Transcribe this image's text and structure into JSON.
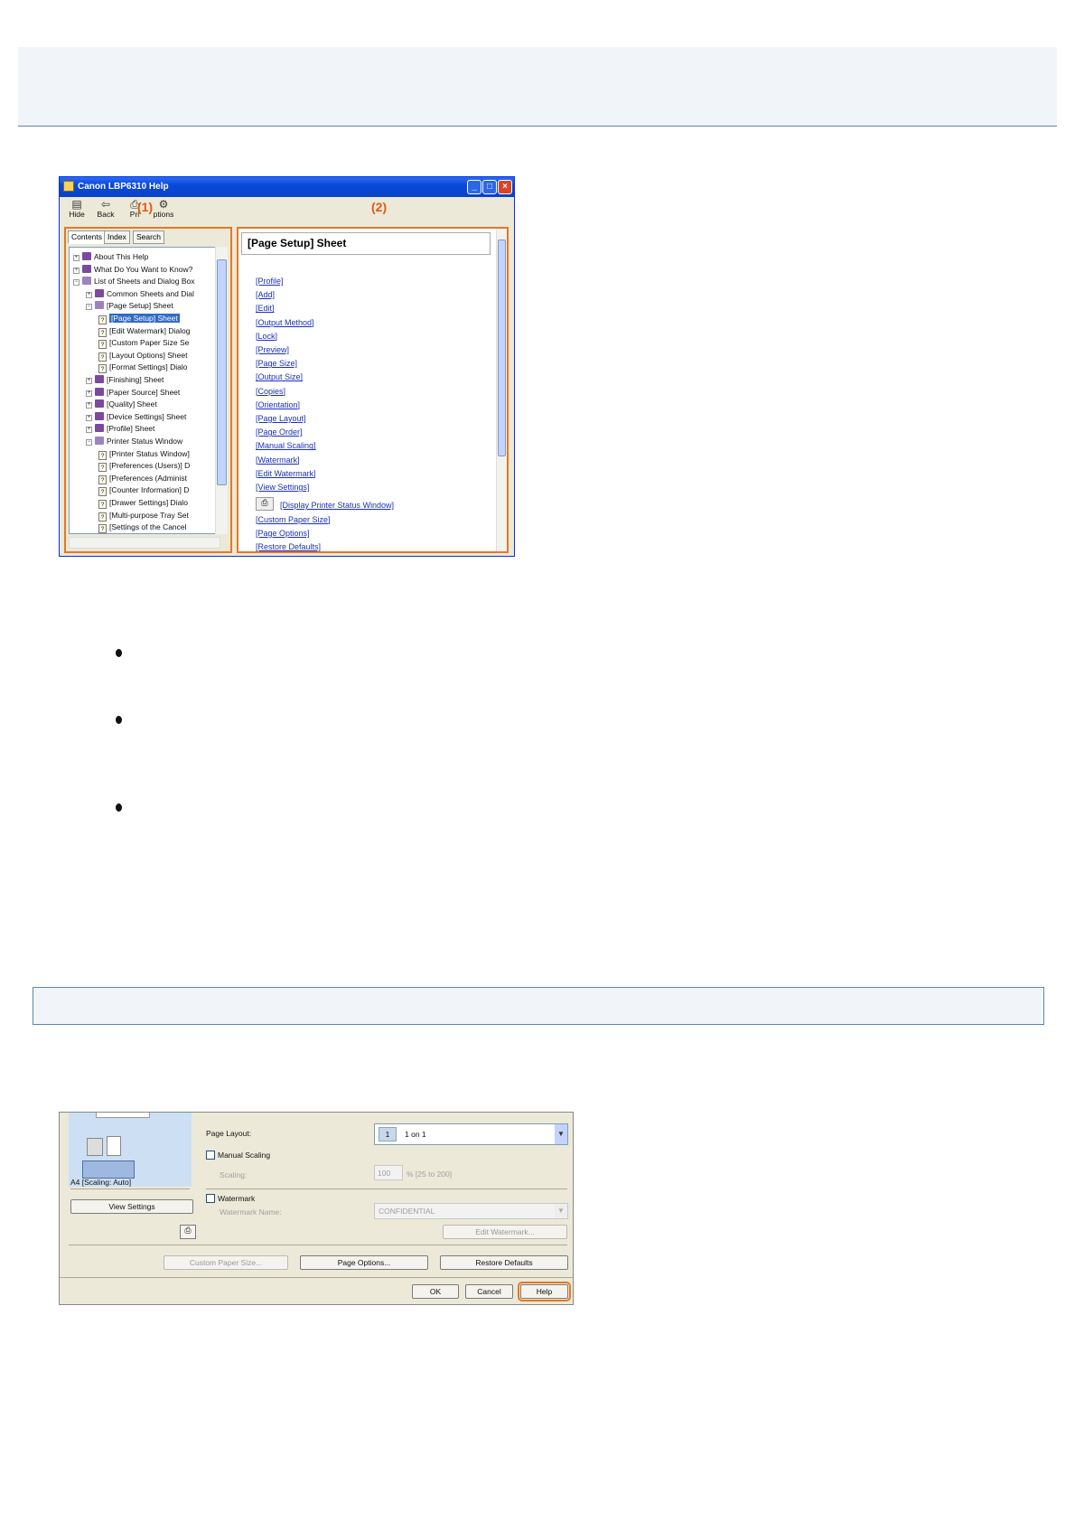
{
  "help_window": {
    "title": "Canon LBP6310 Help",
    "toolbar": {
      "hide": "Hide",
      "back": "Back",
      "print": "Pri",
      "options": "ptions"
    },
    "callout_1": "(1)",
    "callout_2": "(2)",
    "tabs": [
      "Contents",
      "Index",
      "Search"
    ],
    "tree": [
      {
        "label": "About This Help",
        "kind": "book",
        "level": 0
      },
      {
        "label": "What Do You Want to Know?",
        "kind": "book",
        "level": 0
      },
      {
        "label": "List of Sheets and Dialog Box",
        "kind": "open",
        "level": 0
      },
      {
        "label": "Common Sheets and Dial",
        "kind": "book",
        "level": 1
      },
      {
        "label": "[Page Setup] Sheet",
        "kind": "open",
        "level": 1
      },
      {
        "label": "[Page Setup] Sheet",
        "kind": "page",
        "level": 2,
        "selected": true
      },
      {
        "label": "[Edit Watermark] Dialog",
        "kind": "page",
        "level": 2
      },
      {
        "label": "[Custom Paper Size Se",
        "kind": "page",
        "level": 2
      },
      {
        "label": "[Layout Options] Sheet",
        "kind": "page",
        "level": 2
      },
      {
        "label": "[Format Settings] Dialo",
        "kind": "page",
        "level": 2
      },
      {
        "label": "[Finishing] Sheet",
        "kind": "book",
        "level": 1
      },
      {
        "label": "[Paper Source] Sheet",
        "kind": "book",
        "level": 1
      },
      {
        "label": "[Quality] Sheet",
        "kind": "book",
        "level": 1
      },
      {
        "label": "[Device Settings] Sheet",
        "kind": "book",
        "level": 1
      },
      {
        "label": "[Profile] Sheet",
        "kind": "book",
        "level": 1
      },
      {
        "label": "Printer Status Window",
        "kind": "open",
        "level": 1
      },
      {
        "label": "[Printer Status Window]",
        "kind": "page",
        "level": 2
      },
      {
        "label": "[Preferences (Users)] D",
        "kind": "page",
        "level": 2
      },
      {
        "label": "[Preferences (Administ",
        "kind": "page",
        "level": 2
      },
      {
        "label": "[Counter Information] D",
        "kind": "page",
        "level": 2
      },
      {
        "label": "[Drawer Settings] Dialo",
        "kind": "page",
        "level": 2
      },
      {
        "label": "[Multi-purpose Tray Set",
        "kind": "page",
        "level": 2
      },
      {
        "label": "[Settings of the Cancel",
        "kind": "page",
        "level": 2
      }
    ],
    "content_title": "[Page Setup] Sheet",
    "links": [
      "[Profile]",
      "[Add]",
      "[Edit]",
      "[Output Method]",
      "[Lock]",
      "[Preview]",
      "[Page Size]",
      "[Output Size]",
      "[Copies]",
      "[Orientation]",
      "[Page Layout]",
      "[Page Order]",
      "[Manual Scaling]",
      "[Watermark]",
      "[Edit Watermark]",
      "[View Settings]"
    ],
    "link_status_window": "[Display Printer Status Window]",
    "links_after": [
      "[Custom Paper Size]",
      "[Page Options]",
      "[Restore Defaults]"
    ]
  },
  "dialog": {
    "preview_caption": "A4 [Scaling: Auto]",
    "view_settings": "View Settings",
    "page_layout_label": "Page Layout:",
    "page_layout_value": "1 on 1",
    "page_layout_num": "1",
    "manual_scaling": "Manual Scaling",
    "scaling_label": "Scaling:",
    "scaling_value": "100",
    "scaling_range": "% [25 to 200]",
    "watermark": "Watermark",
    "watermark_name_label": "Watermark Name:",
    "watermark_name_value": "CONFIDENTIAL",
    "edit_watermark": "Edit Watermark...",
    "custom_paper_size": "Custom Paper Size...",
    "page_options": "Page Options...",
    "restore_defaults": "Restore Defaults",
    "ok": "OK",
    "cancel": "Cancel",
    "help": "Help"
  }
}
